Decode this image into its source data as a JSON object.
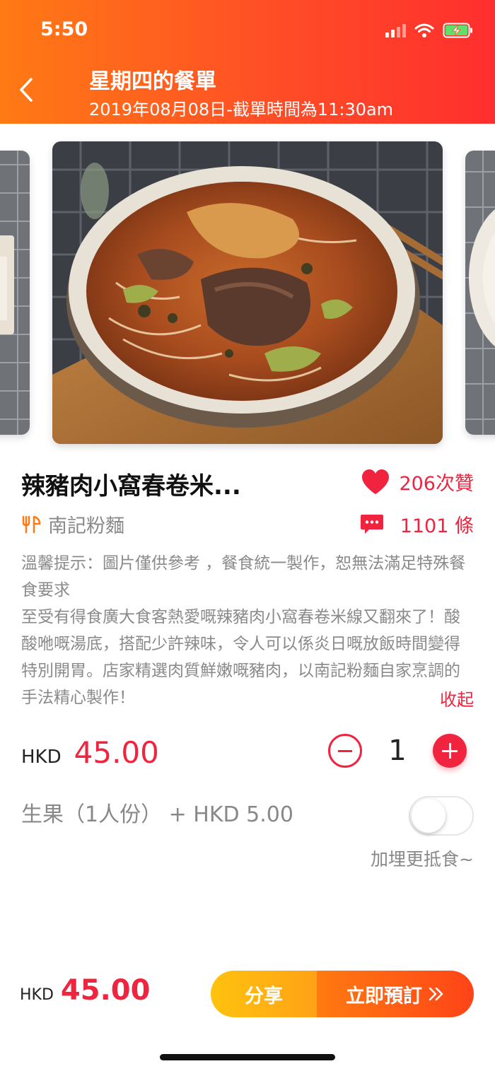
{
  "status_bar": {
    "time": "5:50"
  },
  "header": {
    "title": "星期四的餐單",
    "subtitle": "2019年08月08日-截單時間為11:30am"
  },
  "dish": {
    "name": "辣豬肉小窩春卷米...",
    "likes": "206次贊",
    "restaurant": "南記粉麵",
    "comments": "1101 條",
    "notice": "溫馨提示：圖片僅供參考 ，餐食統一製作，恕無法滿足特殊餐食要求",
    "description": "至受有得食廣大食客熱愛嘅辣豬肉小窩春卷米線又翻來了！酸酸咃嘅湯底，搭配少許辣味，令人可以係炎日嘅放飯時間變得特別開胃。店家精選肉質鮮嫩嘅豬肉，以南記粉麵自家烹調的手法精心製作！",
    "collapse_label": "收起"
  },
  "price": {
    "currency": "HKD",
    "amount": "45.00"
  },
  "quantity": "1",
  "addon": {
    "label": "生果（1人份） + HKD 5.00",
    "hint": "加埋更抵食~",
    "enabled": false
  },
  "footer": {
    "currency": "HKD",
    "total": "45.00",
    "share_label": "分享",
    "order_label": "立即預訂"
  },
  "colors": {
    "accent": "#f1243f",
    "header_start": "#ff7a14",
    "header_end": "#ff2e2e"
  }
}
